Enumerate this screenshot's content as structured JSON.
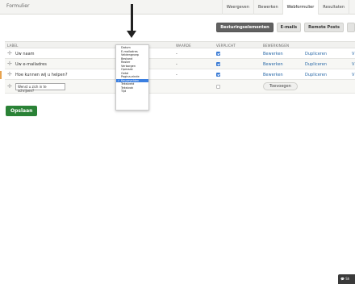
{
  "header": {
    "title": "Formulier",
    "tabs": [
      {
        "label": "Weergeven"
      },
      {
        "label": "Bewerken"
      },
      {
        "label": "Webformulier"
      },
      {
        "label": "Resultaten"
      },
      {
        "label": ""
      }
    ]
  },
  "subtabs": [
    {
      "label": "Besturingselementen"
    },
    {
      "label": "E-mails"
    },
    {
      "label": "Remote Posts"
    }
  ],
  "table": {
    "headers": {
      "label": "LABEL",
      "value": "WAARDE",
      "required": "VERPLICHT",
      "operations": "BEWERKINGEN"
    },
    "rows": [
      {
        "label": "Uw naam",
        "value": "-",
        "required": true,
        "edit": "Bewerken",
        "duplicate": "Dupliceren",
        "extra": "V"
      },
      {
        "label": "Uw e-mailadres",
        "value": "-",
        "required": true,
        "edit": "Bewerken",
        "duplicate": "Dupliceren",
        "extra": "V"
      },
      {
        "label": "Hoe kunnen wij u helpen?",
        "value": "-",
        "required": true,
        "edit": "Bewerken",
        "duplicate": "Dupliceren",
        "extra": "V"
      }
    ],
    "new_row": {
      "label_value": "Wenst u zich in te schrijven?",
      "required": false,
      "add_button": "Toevoegen"
    }
  },
  "type_dropdown": {
    "options": [
      "Datum",
      "E-mailadres",
      "Veldengroep",
      "Bestand",
      "Raster",
      "Verborgen",
      "Opmaak",
      "Getal",
      "Pagina-einde",
      "Keuzevelden",
      "Tekstveld",
      "Tekstvak",
      "Tijd"
    ],
    "selected": "Keuzevelden"
  },
  "actions": {
    "save": "Opslaan"
  },
  "chat_button": {
    "label": "Sh"
  },
  "colors": {
    "save": "#2a8236",
    "link": "#2b6aa8",
    "selected_option": "#3b7fe0",
    "active_subtab": "#616161"
  }
}
